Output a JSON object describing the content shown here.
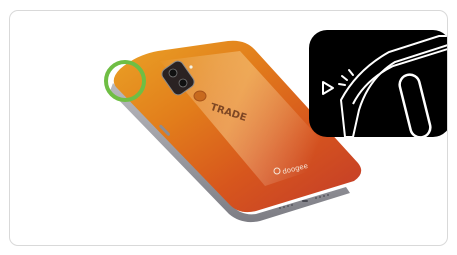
{
  "phone": {
    "model_text": "TRADE",
    "brand_text": "doogee"
  },
  "highlight": {
    "color": "#6fbe44",
    "target": "side-button"
  },
  "inset": {
    "action": "press",
    "arrow_icon": "play-arrow-outline-icon"
  },
  "colors": {
    "body_top": "#e48a1c",
    "body_mid": "#d9641a",
    "body_bottom": "#c0392b",
    "frame_border": "#d9d9d9",
    "inset_bg": "#000000"
  }
}
